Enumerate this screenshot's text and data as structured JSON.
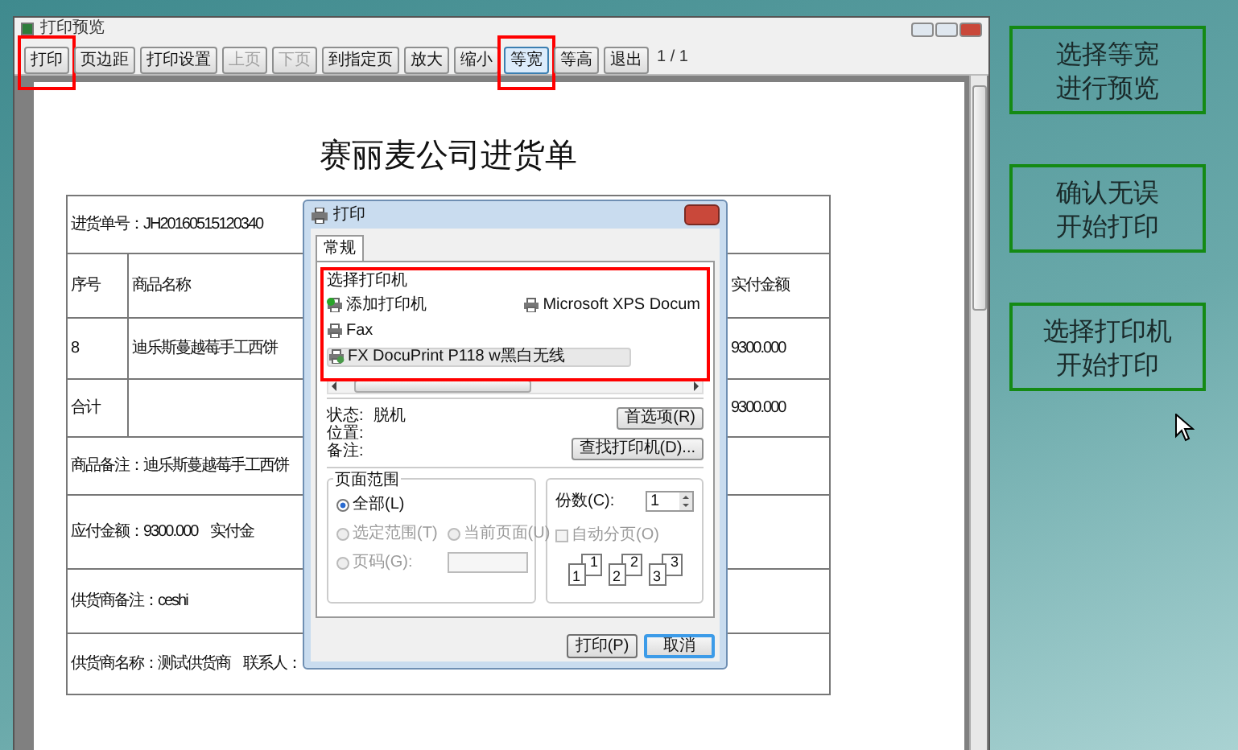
{
  "preview_window": {
    "title": "打印预览",
    "toolbar": [
      {
        "label": "打印",
        "disabled": false,
        "pressed": false,
        "highlighted": true
      },
      {
        "label": "页边距",
        "disabled": false,
        "pressed": false,
        "highlighted": false
      },
      {
        "label": "打印设置",
        "disabled": false,
        "pressed": false,
        "highlighted": false
      },
      {
        "label": "上页",
        "disabled": true,
        "pressed": false,
        "highlighted": false
      },
      {
        "label": "下页",
        "disabled": true,
        "pressed": false,
        "highlighted": false
      },
      {
        "label": "到指定页",
        "disabled": false,
        "pressed": false,
        "highlighted": false
      },
      {
        "label": "放大",
        "disabled": false,
        "pressed": false,
        "highlighted": false
      },
      {
        "label": "缩小",
        "disabled": false,
        "pressed": false,
        "highlighted": false
      },
      {
        "label": "等宽",
        "disabled": false,
        "pressed": true,
        "highlighted": true
      },
      {
        "label": "等高",
        "disabled": false,
        "pressed": false,
        "highlighted": false
      },
      {
        "label": "退出",
        "disabled": false,
        "pressed": false,
        "highlighted": false
      }
    ],
    "page_indicator": "1 / 1",
    "document": {
      "title": "赛丽麦公司进货单",
      "rows": [
        {
          "kind": "full",
          "cells": [
            "进货单号：JH20160515120340"
          ]
        },
        {
          "kind": "columns",
          "cells": [
            "序号",
            "商品名称",
            "实付金额"
          ]
        },
        {
          "kind": "columns",
          "cells": [
            "8",
            "迪乐斯蔓越莓手工西饼",
            "9300.000"
          ]
        },
        {
          "kind": "columns",
          "cells": [
            "合计",
            null,
            "9300.000"
          ]
        },
        {
          "kind": "full",
          "cells": [
            "商品备注：迪乐斯蔓越莓手工西饼"
          ]
        },
        {
          "kind": "pair",
          "cells": [
            "应付金额：9300.000",
            "实付金"
          ]
        },
        {
          "kind": "full",
          "cells": [
            "供货商备注：ceshi"
          ]
        },
        {
          "kind": "pair",
          "cells": [
            "供货商名称：测试供货商",
            "联系人："
          ]
        }
      ]
    }
  },
  "print_dialog": {
    "title": "打印",
    "tabs": [
      {
        "label": "常规",
        "selected": true
      }
    ],
    "printer_group": {
      "title": "选择打印机",
      "highlighted": true,
      "printers": [
        {
          "name": "添加打印机",
          "kind": "add",
          "selected": false
        },
        {
          "name": "Microsoft XPS Docum",
          "kind": "printer",
          "selected": false
        },
        {
          "name": "Fax",
          "kind": "printer",
          "selected": false
        },
        {
          "name": "FX DocuPrint P118 w黑白无线",
          "kind": "network",
          "selected": true
        }
      ]
    },
    "status": [
      {
        "label": "状态:",
        "value": "脱机"
      },
      {
        "label": "位置:"
      },
      {
        "label": "备注:"
      }
    ],
    "preferences_button": "首选项(R)",
    "find_printer_button": "查找打印机(D)...",
    "page_range": {
      "title": "页面范围",
      "options": [
        {
          "label": "全部(L)",
          "kind": "radio",
          "selected": true,
          "disabled": false
        },
        {
          "label": "选定范围(T)",
          "kind": "radio",
          "selected": false,
          "disabled": true
        },
        {
          "label": "当前页面(U)",
          "kind": "radio",
          "selected": false,
          "disabled": true
        },
        {
          "label": "页码(G):",
          "kind": "radio_field",
          "selected": false,
          "disabled": true
        }
      ]
    },
    "copies": {
      "label": "份数(C):",
      "value": "1",
      "collate": {
        "label": "自动分页(O)",
        "checked": false,
        "disabled": true
      },
      "collate_pages": [
        "1",
        "1",
        "2",
        "2",
        "3",
        "3"
      ]
    },
    "buttons": [
      {
        "label": "打印(P)",
        "default": false
      },
      {
        "label": "取消",
        "default": true
      }
    ]
  },
  "notes": [
    {
      "lines": [
        "选择等宽",
        "进行预览"
      ]
    },
    {
      "lines": [
        "确认无误",
        "开始打印"
      ]
    },
    {
      "lines": [
        "选择打印机",
        "开始打印"
      ]
    }
  ]
}
